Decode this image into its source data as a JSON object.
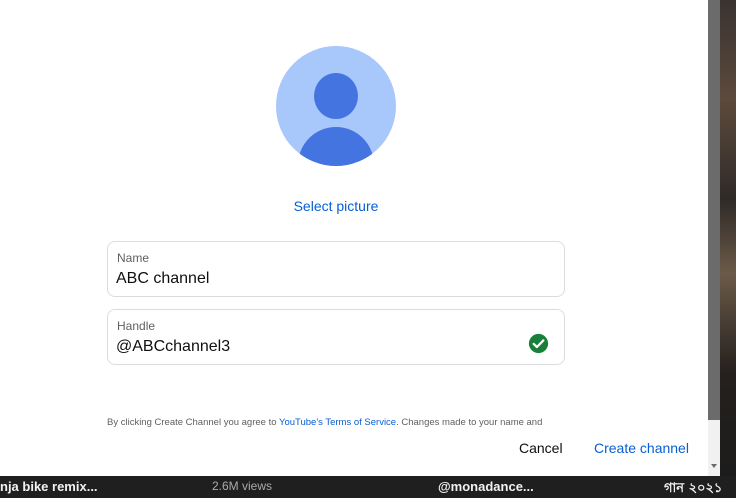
{
  "dialog": {
    "select_picture": "Select picture",
    "name_field": {
      "label": "Name",
      "value": "ABC channel"
    },
    "handle_field": {
      "label": "Handle",
      "value": "@ABCchannel3",
      "status_icon": "check-circle-icon"
    },
    "terms": {
      "prefix": "By clicking Create Channel you agree to ",
      "link": "YouTube's Terms of Service",
      "suffix": ". Changes made to your name and"
    },
    "cancel_label": "Cancel",
    "create_label": "Create channel"
  },
  "background": {
    "video_title_left": "nja bike remix...",
    "views": "2.6M views",
    "channel": "@monadance...",
    "video_title_right": "গান ২০২১"
  },
  "colors": {
    "link": "#065fd4",
    "avatar_bg": "#a8c7fa",
    "avatar_fg": "#4374e0",
    "check": "#188038"
  }
}
